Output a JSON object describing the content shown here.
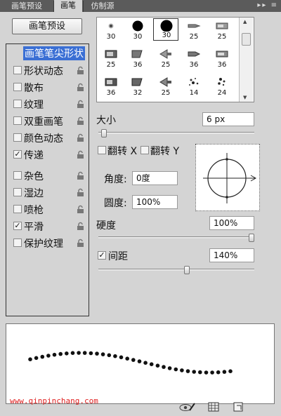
{
  "tabs": [
    {
      "label": "画笔预设"
    },
    {
      "label": "画笔"
    },
    {
      "label": "仿制源"
    }
  ],
  "panel_menu_icon": "double-chevron-menu",
  "preset_button": "画笔预设",
  "options": {
    "header": "画笔笔尖形状",
    "items": [
      {
        "label": "形状动态",
        "checked": false
      },
      {
        "label": "散布",
        "checked": false
      },
      {
        "label": "纹理",
        "checked": false
      },
      {
        "label": "双重画笔",
        "checked": false
      },
      {
        "label": "颜色动态",
        "checked": false
      },
      {
        "label": "传递",
        "checked": true
      },
      {
        "label": "杂色",
        "checked": false
      },
      {
        "label": "湿边",
        "checked": false
      },
      {
        "label": "喷枪",
        "checked": false
      },
      {
        "label": "平滑",
        "checked": true
      },
      {
        "label": "保护纹理",
        "checked": false
      }
    ],
    "check_mark": "✓"
  },
  "brush_tips": [
    {
      "size": "30",
      "shape": "soft-dot"
    },
    {
      "size": "30",
      "shape": "hard-round"
    },
    {
      "size": "30",
      "shape": "hard-round-large"
    },
    {
      "size": "25",
      "shape": "marker"
    },
    {
      "size": "25",
      "shape": "flat"
    },
    {
      "size": "25",
      "shape": "square"
    },
    {
      "size": "36",
      "shape": "angled"
    },
    {
      "size": "25",
      "shape": "fan"
    },
    {
      "size": "36",
      "shape": "marker"
    },
    {
      "size": "36",
      "shape": "flat"
    },
    {
      "size": "36",
      "shape": "square"
    },
    {
      "size": "32",
      "shape": "angled"
    },
    {
      "size": "25",
      "shape": "fan"
    },
    {
      "size": "14",
      "shape": "scatter"
    },
    {
      "size": "24",
      "shape": "scatter"
    }
  ],
  "size": {
    "label": "大小",
    "value": "6 px",
    "level_percent": 2
  },
  "flip": {
    "x_label": "翻转 X",
    "y_label": "翻转 Y"
  },
  "angle": {
    "label": "角度:",
    "value": "0度"
  },
  "roundness": {
    "label": "圆度:",
    "value": "100%"
  },
  "hardness": {
    "label": "硬度",
    "value": "100%",
    "level_percent": 100
  },
  "spacing": {
    "label": "间距",
    "value": "140%",
    "checked": true,
    "level_percent": 57
  },
  "watermark": "www.qinpinchang.com",
  "bottom_icons": [
    "eye-brush-icon",
    "grid-icon",
    "new-page-icon"
  ],
  "colors": {
    "accent": "#3a6fd4",
    "watermark": "#e02020"
  }
}
